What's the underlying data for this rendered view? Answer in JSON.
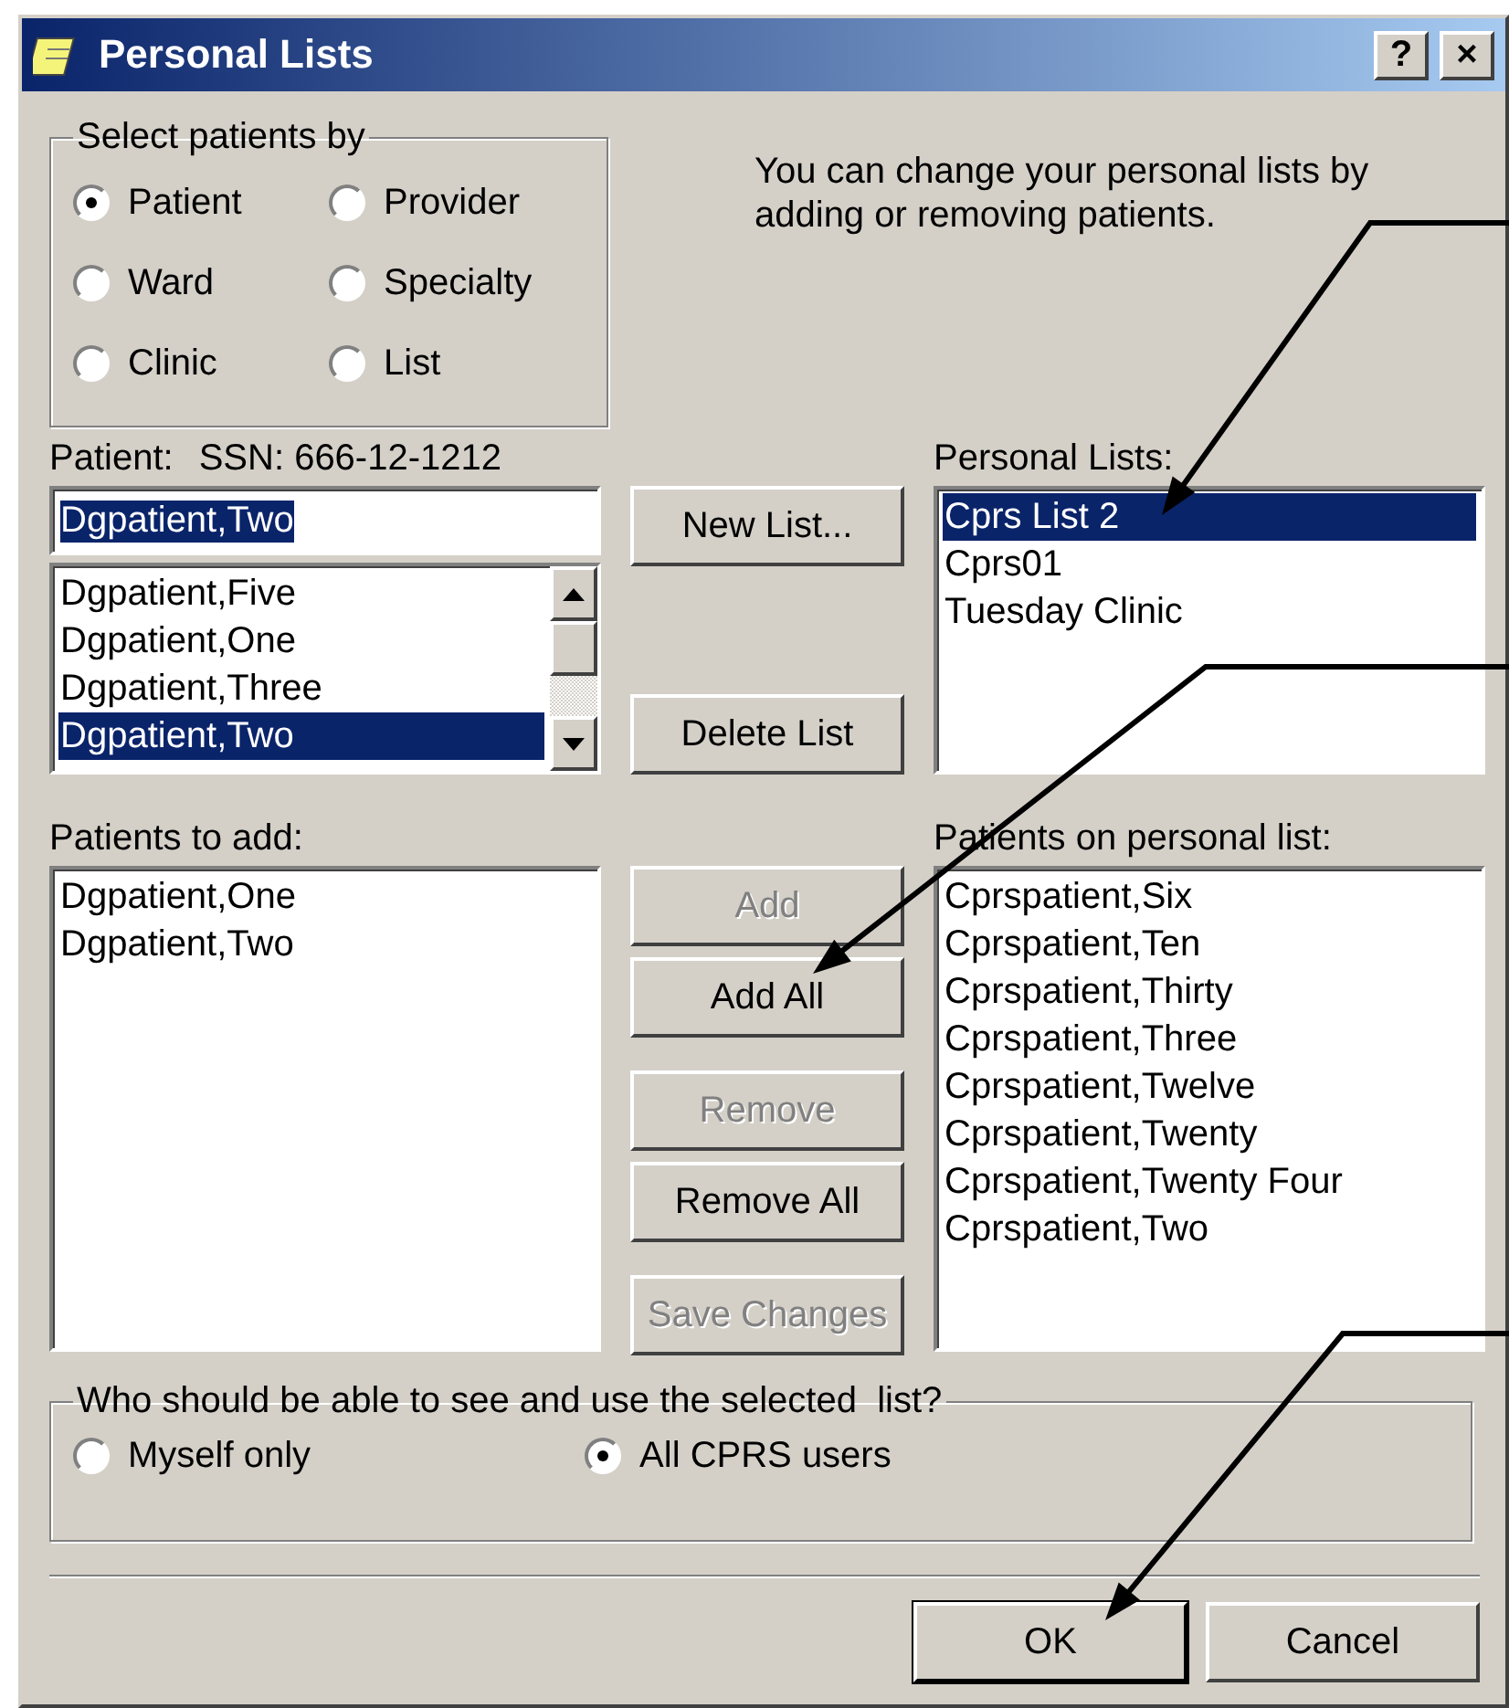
{
  "window": {
    "title": "Personal Lists",
    "controls": [
      "?",
      "×"
    ]
  },
  "select_by": {
    "legend": "Select patients by",
    "options": [
      {
        "label": "Patient",
        "selected": true
      },
      {
        "label": "Provider",
        "selected": false
      },
      {
        "label": "Ward",
        "selected": false
      },
      {
        "label": "Specialty",
        "selected": false
      },
      {
        "label": "Clinic",
        "selected": false
      },
      {
        "label": "List",
        "selected": false
      }
    ]
  },
  "info_text": "You can change your personal lists by adding or removing patients.",
  "patient": {
    "label": "Patient:",
    "ssn": "SSN: 666-12-1212",
    "field": {
      "value": "Dgpatient,Two",
      "highlighted": true
    },
    "items": [
      {
        "label": "Dgpatient,Five",
        "selected": false
      },
      {
        "label": "Dgpatient,One",
        "selected": false
      },
      {
        "label": "Dgpatient,Three",
        "selected": false
      },
      {
        "label": "Dgpatient,Two",
        "selected": true
      }
    ]
  },
  "list_buttons": [
    {
      "label": "New List...",
      "disabled": false
    },
    {
      "label": "Delete List",
      "disabled": false
    }
  ],
  "personal_lists": {
    "label": "Personal Lists:",
    "items": [
      {
        "label": "Cprs List 2",
        "selected": true
      },
      {
        "label": "Cprs01",
        "selected": false
      },
      {
        "label": "Tuesday Clinic",
        "selected": false
      }
    ]
  },
  "patients_to_add": {
    "label": "Patients to add:",
    "items": [
      "Dgpatient,One",
      "Dgpatient,Two"
    ]
  },
  "action_buttons": [
    {
      "label": "Add",
      "disabled": true
    },
    {
      "label": "Add All",
      "disabled": false
    },
    {
      "label": "Remove",
      "disabled": true
    },
    {
      "label": "Remove All",
      "disabled": false
    },
    {
      "label": "Save Changes",
      "disabled": true
    }
  ],
  "patients_on_list": {
    "label": "Patients on personal list:",
    "items": [
      "Cprspatient,Six",
      "Cprspatient,Ten",
      "Cprspatient,Thirty",
      "Cprspatient,Three",
      "Cprspatient,Twelve",
      "Cprspatient,Twenty",
      "Cprspatient,Twenty Four",
      "Cprspatient,Two"
    ]
  },
  "visibility": {
    "legend": "Who should be able to see and use the selected  list?",
    "options": [
      {
        "label": "Myself only",
        "selected": false
      },
      {
        "label": "All CPRS users",
        "selected": true
      }
    ]
  },
  "footer_buttons": [
    {
      "label": "OK",
      "default": true
    },
    {
      "label": "Cancel",
      "default": false
    }
  ]
}
